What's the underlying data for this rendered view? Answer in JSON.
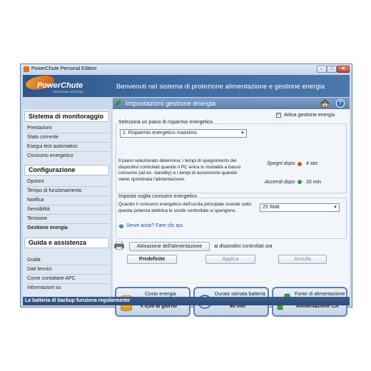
{
  "window": {
    "title": "PowerChute Personal Edition",
    "controls": {
      "minimize": "–",
      "maximize": "□",
      "close": "✕"
    }
  },
  "banner": {
    "logo_name": "PowerChute",
    "logo_sub": "PERSONAL EDITION",
    "welcome": "Benvenuti nel sistema di protezione alimentazione e gestione energia"
  },
  "section": {
    "title": "Impostazioni gestione energia"
  },
  "sidebar": {
    "groups": [
      {
        "heading": "Sistema di monitoraggio",
        "items": [
          "Prestazioni",
          "Stato corrente",
          "Esegui test automatico",
          "Consumo energetico"
        ]
      },
      {
        "heading": "Configurazione",
        "items": [
          "Opzioni",
          "Tempo di funzionamento",
          "Notifica",
          "Sensibilità",
          "Tensione",
          "Gestione energia"
        ]
      },
      {
        "heading": "Guida e assistenza",
        "items": [
          "Guida",
          "Dati tecnici",
          "Come contattare APC",
          "Informazioni su"
        ]
      }
    ],
    "active": "Gestione energia"
  },
  "content": {
    "enable_label": "Attiva gestione energia",
    "enable_checked": true,
    "plan_group_title": "Seleziona un piano di risparmio energetico",
    "plan_selected": "2. Risparmio energetico massimo",
    "plan_description": "Il piano selezionato determina: i tempi di spegnimento dei dispositivi controllati quando il PC entra in modalità a basso consumo (ad es. standby) e i tempi di accensione quando viene ripristinata l'alimentazione.",
    "off_label": "Spegni dopo",
    "off_value": "4 sec",
    "on_label": "Accendi dopo",
    "on_value": "20 min",
    "threshold_group_title": "Imposta soglia consumo energetico",
    "threshold_description": "Quando il consumo energetico dell'uscita principale scende sotto questa potenza elettrica le uscite controllate si spengono.",
    "threshold_selected": "25 Watt",
    "help_link": "Serve aiuto? Fare clic qui.",
    "power_button": "Attivazione dell'alimentazione",
    "power_suffix": "ai dispositivi controllati ora",
    "btn_defaults": "Predefinite",
    "btn_apply": "Applica",
    "btn_cancel": "Annulla"
  },
  "tiles": [
    {
      "title": "Costo energia",
      "value": "€ 0,00 al giorno",
      "icon": "coins-icon"
    },
    {
      "title": "Durata stimata batteria",
      "value": "60 min",
      "icon": "battery-gauge-icon"
    },
    {
      "title": "Fonte di alimentazione",
      "value": "Alimentazione CA",
      "icon": "plug-icon"
    }
  ],
  "status": {
    "text": "La batteria di backup funziona regolarmente"
  },
  "colors": {
    "accent": "#2f5689",
    "off_icon": "#e2462b",
    "on_icon": "#2f9a3c"
  }
}
